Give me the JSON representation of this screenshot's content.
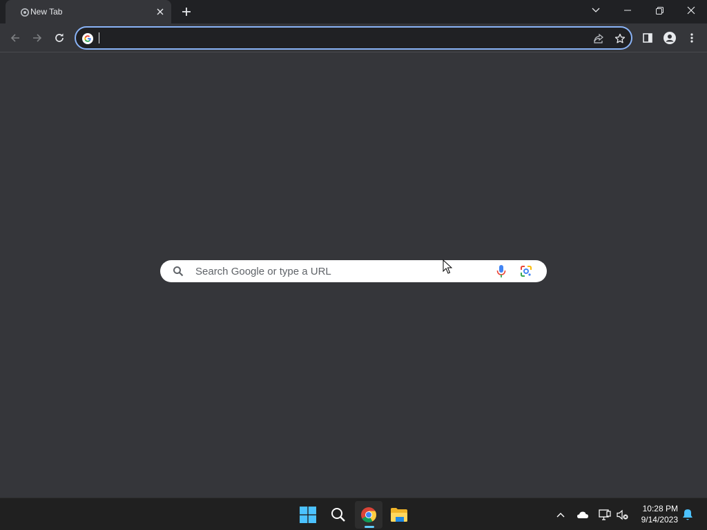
{
  "browser": {
    "tab": {
      "title": "New Tab"
    },
    "omnibox": {
      "value": "",
      "placeholder": ""
    }
  },
  "ntp": {
    "search_placeholder": "Search Google or type a URL"
  },
  "taskbar": {
    "clock": {
      "time": "10:28 PM",
      "date": "9/14/2023"
    }
  },
  "colors": {
    "accent_focus": "#8ab4f8",
    "frame": "#202124",
    "page_bg": "#35363a",
    "taskbar_bg": "#202020",
    "taskbar_indicator": "#60cdff"
  }
}
